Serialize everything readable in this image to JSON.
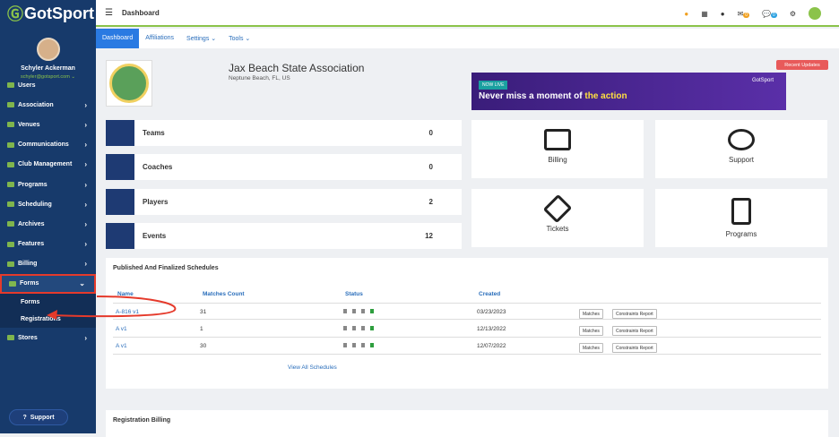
{
  "app": {
    "logo": "GotSport"
  },
  "profile": {
    "name": "Schyler Ackerman",
    "email": "schyler@gotsport.com ⌄"
  },
  "sidebar": {
    "items": [
      {
        "label": "Users"
      },
      {
        "label": "Association"
      },
      {
        "label": "Venues"
      },
      {
        "label": "Communications"
      },
      {
        "label": "Club Management"
      },
      {
        "label": "Programs"
      },
      {
        "label": "Scheduling"
      },
      {
        "label": "Archives"
      },
      {
        "label": "Features"
      },
      {
        "label": "Billing"
      },
      {
        "label": "Forms"
      }
    ],
    "subitems": [
      {
        "label": "Forms"
      },
      {
        "label": "Registrations"
      }
    ],
    "stores": "Stores",
    "support": "Support"
  },
  "topbar": {
    "title": "Dashboard",
    "badge1": "0",
    "badge2": "0"
  },
  "tabs": [
    {
      "label": "Dashboard"
    },
    {
      "label": "Affiliations"
    },
    {
      "label": "Settings ⌄"
    },
    {
      "label": "Tools ⌄"
    }
  ],
  "org": {
    "name": "Jax Beach State Association",
    "location": "Neptune Beach, FL, US"
  },
  "recent_updates": "Recent Updates",
  "banner": {
    "tag": "NOW LIVE",
    "text_a": "Never miss a moment of ",
    "text_b": "the action",
    "brand": "GotSport"
  },
  "stats": [
    {
      "label": "Teams",
      "value": "0"
    },
    {
      "label": "Coaches",
      "value": "0"
    },
    {
      "label": "Players",
      "value": "2"
    },
    {
      "label": "Events",
      "value": "12"
    }
  ],
  "tiles": [
    {
      "label": "Billing"
    },
    {
      "label": "Support"
    },
    {
      "label": "Tickets"
    },
    {
      "label": "Programs"
    }
  ],
  "schedules": {
    "title": "Published And Finalized Schedules",
    "headers": {
      "name": "Name",
      "matches": "Matches Count",
      "status": "Status",
      "created": "Created"
    },
    "rows": [
      {
        "name": "A-816 v1",
        "matches": "31",
        "created": "03/23/2023"
      },
      {
        "name": "A v1",
        "matches": "1",
        "created": "12/13/2022"
      },
      {
        "name": "A v1",
        "matches": "30",
        "created": "12/07/2022"
      }
    ],
    "matches_btn": "Matches",
    "constraints_btn": "Constraints Report",
    "view_all": "View All Schedules"
  },
  "registration_billing": "Registration Billing",
  "colors": {
    "sidebar": "#173a6b",
    "accent": "#8bc34a",
    "highlight": "#e53a2b",
    "link": "#2a6ebb"
  }
}
